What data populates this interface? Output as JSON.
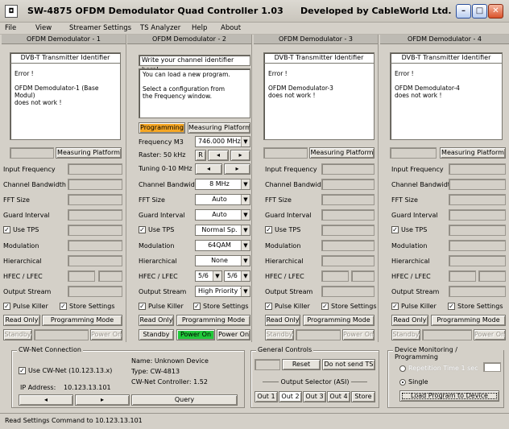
{
  "window": {
    "title": "SW-4875   OFDM Demodulator Quad Controller   1.03",
    "developer": "Developed by CableWorld Ltd."
  },
  "menu": [
    "File",
    "View",
    "Streamer Settings",
    "TS Analyzer",
    "Help",
    "About"
  ],
  "labels": {
    "input_frequency": "Input Frequency",
    "channel_bandwidth": "Channel Bandwidth",
    "fft_size": "FFT Size",
    "guard_interval": "Guard Interval",
    "use_tps": "Use TPS",
    "modulation": "Modulation",
    "hierarchical": "Hierarchical",
    "hfec_lfec": "HFEC / LFEC",
    "output_stream": "Output Stream",
    "pulse_killer": "Pulse Killer",
    "store_settings": "Store Settings",
    "read_only": "Read Only",
    "programming_mode": "Programming Mode",
    "standby": "Standby",
    "power_on": "Power On",
    "measuring_platform": "Measuring Platform"
  },
  "demods": [
    {
      "header": "OFDM Demodulator - 1",
      "box_title": "DVB-T Transmitter Identifier",
      "box_text": "Error !\n\nOFDM Demodulator-1 (Base Modul)\ndoes not work !"
    },
    {
      "header": "OFDM Demodulator - 2",
      "box_title": "Write your channel identifier here!",
      "box_text": "You can load a new program.\n\nSelect a configuration from\n  the Frequency window."
    },
    {
      "header": "OFDM Demodulator - 3",
      "box_title": "DVB-T Transmitter Identifier",
      "box_text": "Error !\n\nOFDM Demodulator-3\ndoes not work !"
    },
    {
      "header": "OFDM Demodulator - 4",
      "box_title": "DVB-T Transmitter Identifier",
      "box_text": "Error !\n\nOFDM Demodulator-4\ndoes not work !"
    }
  ],
  "demod2": {
    "programming_tab": "Programming",
    "frequency_label": "Frequency M3",
    "frequency_value": "746.000 MHz",
    "raster_label": "Raster: 50 kHz",
    "raster_btn": "R",
    "tuning_label": "Tuning 0-10 MHz",
    "channel_bandwidth": "8 MHz",
    "fft_size": "Auto",
    "guard_interval": "Auto",
    "use_tps": "Normal Sp.",
    "modulation": "64QAM",
    "hierarchical": "None",
    "hfec": "5/6",
    "lfec": "5/6",
    "output_stream": "High Priority T"
  },
  "cwnet": {
    "group_title": "CW-Net Connection",
    "use_label": "Use CW-Net (10.123.13.x)",
    "ip_label": "IP Address:",
    "ip_value": "10.123.13.101",
    "name_line": "Name: Unknown Device",
    "type_line": "Type: CW-4813",
    "controller_line": "CW-Net Controller:  1.52",
    "query_label": "Query"
  },
  "general": {
    "group_title": "General Controls",
    "reset_label": "Reset",
    "do_not_send_label": "Do not send TS",
    "output_selector_label": "Output Selector (ASI)",
    "outputs": [
      "Out 1",
      "Out 2",
      "Out 3",
      "Out 4",
      "Store"
    ]
  },
  "monitoring": {
    "group_title": "Device Monitoring / Programming",
    "repetition_label": "Repetition Time 1 sec",
    "single_label": "Single",
    "load_label": "Load Program to Device"
  },
  "status": {
    "text": "Read Settings Command to 10.123.13.101"
  }
}
